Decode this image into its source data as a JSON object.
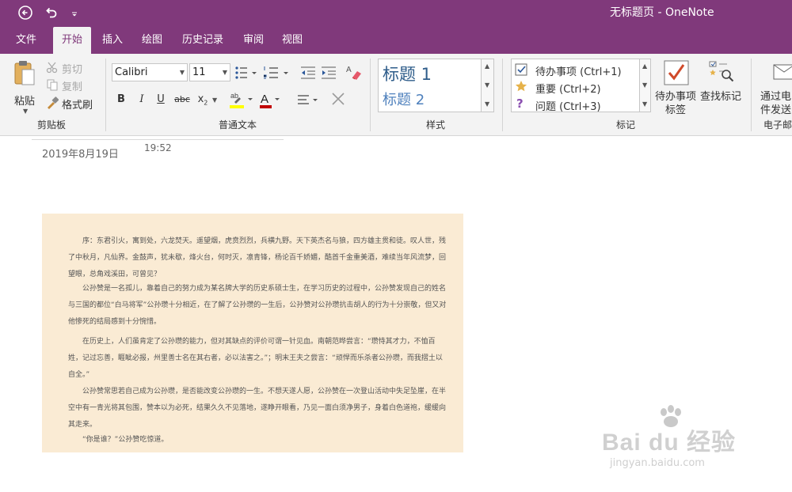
{
  "window": {
    "title": "无标题页 - OneNote",
    "accent_color": "#80397b"
  },
  "quick_access": {
    "back_icon": "back-circle-icon",
    "undo_icon": "undo-icon",
    "customize_icon": "chevron-down-icon"
  },
  "tabs": [
    "文件",
    "开始",
    "插入",
    "绘图",
    "历史记录",
    "审阅",
    "视图"
  ],
  "active_tab": "开始",
  "ribbon": {
    "clipboard": {
      "paste": "粘贴",
      "cut": "剪切",
      "copy": "复制",
      "format_painter": "格式刷",
      "label": "剪贴板"
    },
    "basic_text": {
      "font": "Calibri",
      "size": "11",
      "label": "普通文本"
    },
    "styles": {
      "heading1": "标题 1",
      "heading2": "标题 2",
      "label": "样式"
    },
    "tags": {
      "items": [
        "待办事项 (Ctrl+1)",
        "重要 (Ctrl+2)",
        "问题 (Ctrl+3)"
      ],
      "todo_tag": "待办事项标签",
      "todo_tag_line1": "待办事项",
      "todo_tag_line2": "标签",
      "find_tags": "查找标记",
      "label": "标记"
    },
    "email": {
      "line1": "通过电",
      "line2": "件发送",
      "label": "电子邮"
    }
  },
  "page": {
    "date": "2019年8月19日",
    "time": "19:52",
    "image_paragraphs": [
      "序：东君引火，寓到处，六龙焚天。遥望烟，虎贲烈烈，兵横九野。天下英杰名与狼，四方雄主贯和徒。叹人世，残了中秋月，凡仙界。金鼓声，犹未歇，烽火台，何时灭，凛青锋，杨论百千娇媚，酷首千金重美酒，难续当年风流梦，回望眼，总角戏溪田，可曾见？",
      "公孙赞是一名孤儿，靠着自己的努力成为某名牌大学的历史系硕士生，在学习历史的过程中，公孙赞发现自己的姓名与三国的都位“白马将军”公孙瓒十分相近，在了解了公孙瓒的一生后，公孙赞对公孙瓒抗击胡人的行为十分崇敬，但又对他惨死的结局感到十分惋惜。",
      "在历史上，人们虽肯定了公孙瓒的能力，但对其缺点的评价可谓一针见血。南朝范晔尝言：“瓒恃其才力，不恤百姓，记过忘善，睚眦必报，州里善士名在其右者，必以法害之。”；明末王夫之尝言：“顽悍而乐杀者公孙瓒，而我摺土以自全。”",
      "公孙赞常思若自己成为公孙瓒，是否能改变公孙瓒的一生。不想天遂人愿，公孙赞在一次登山活动中失足坠崖，在半空中有一青光将其包围，赞本以为必死，结果久久不见落地，遂睁开眼看，乃见一面白须净男子，身着白色道袍，缓缓向其走来。",
      "“你是谁？”公孙赞吃惊道。"
    ]
  },
  "watermark": {
    "brand": "Bai du 经验",
    "url": "jingyan.baidu.com"
  }
}
